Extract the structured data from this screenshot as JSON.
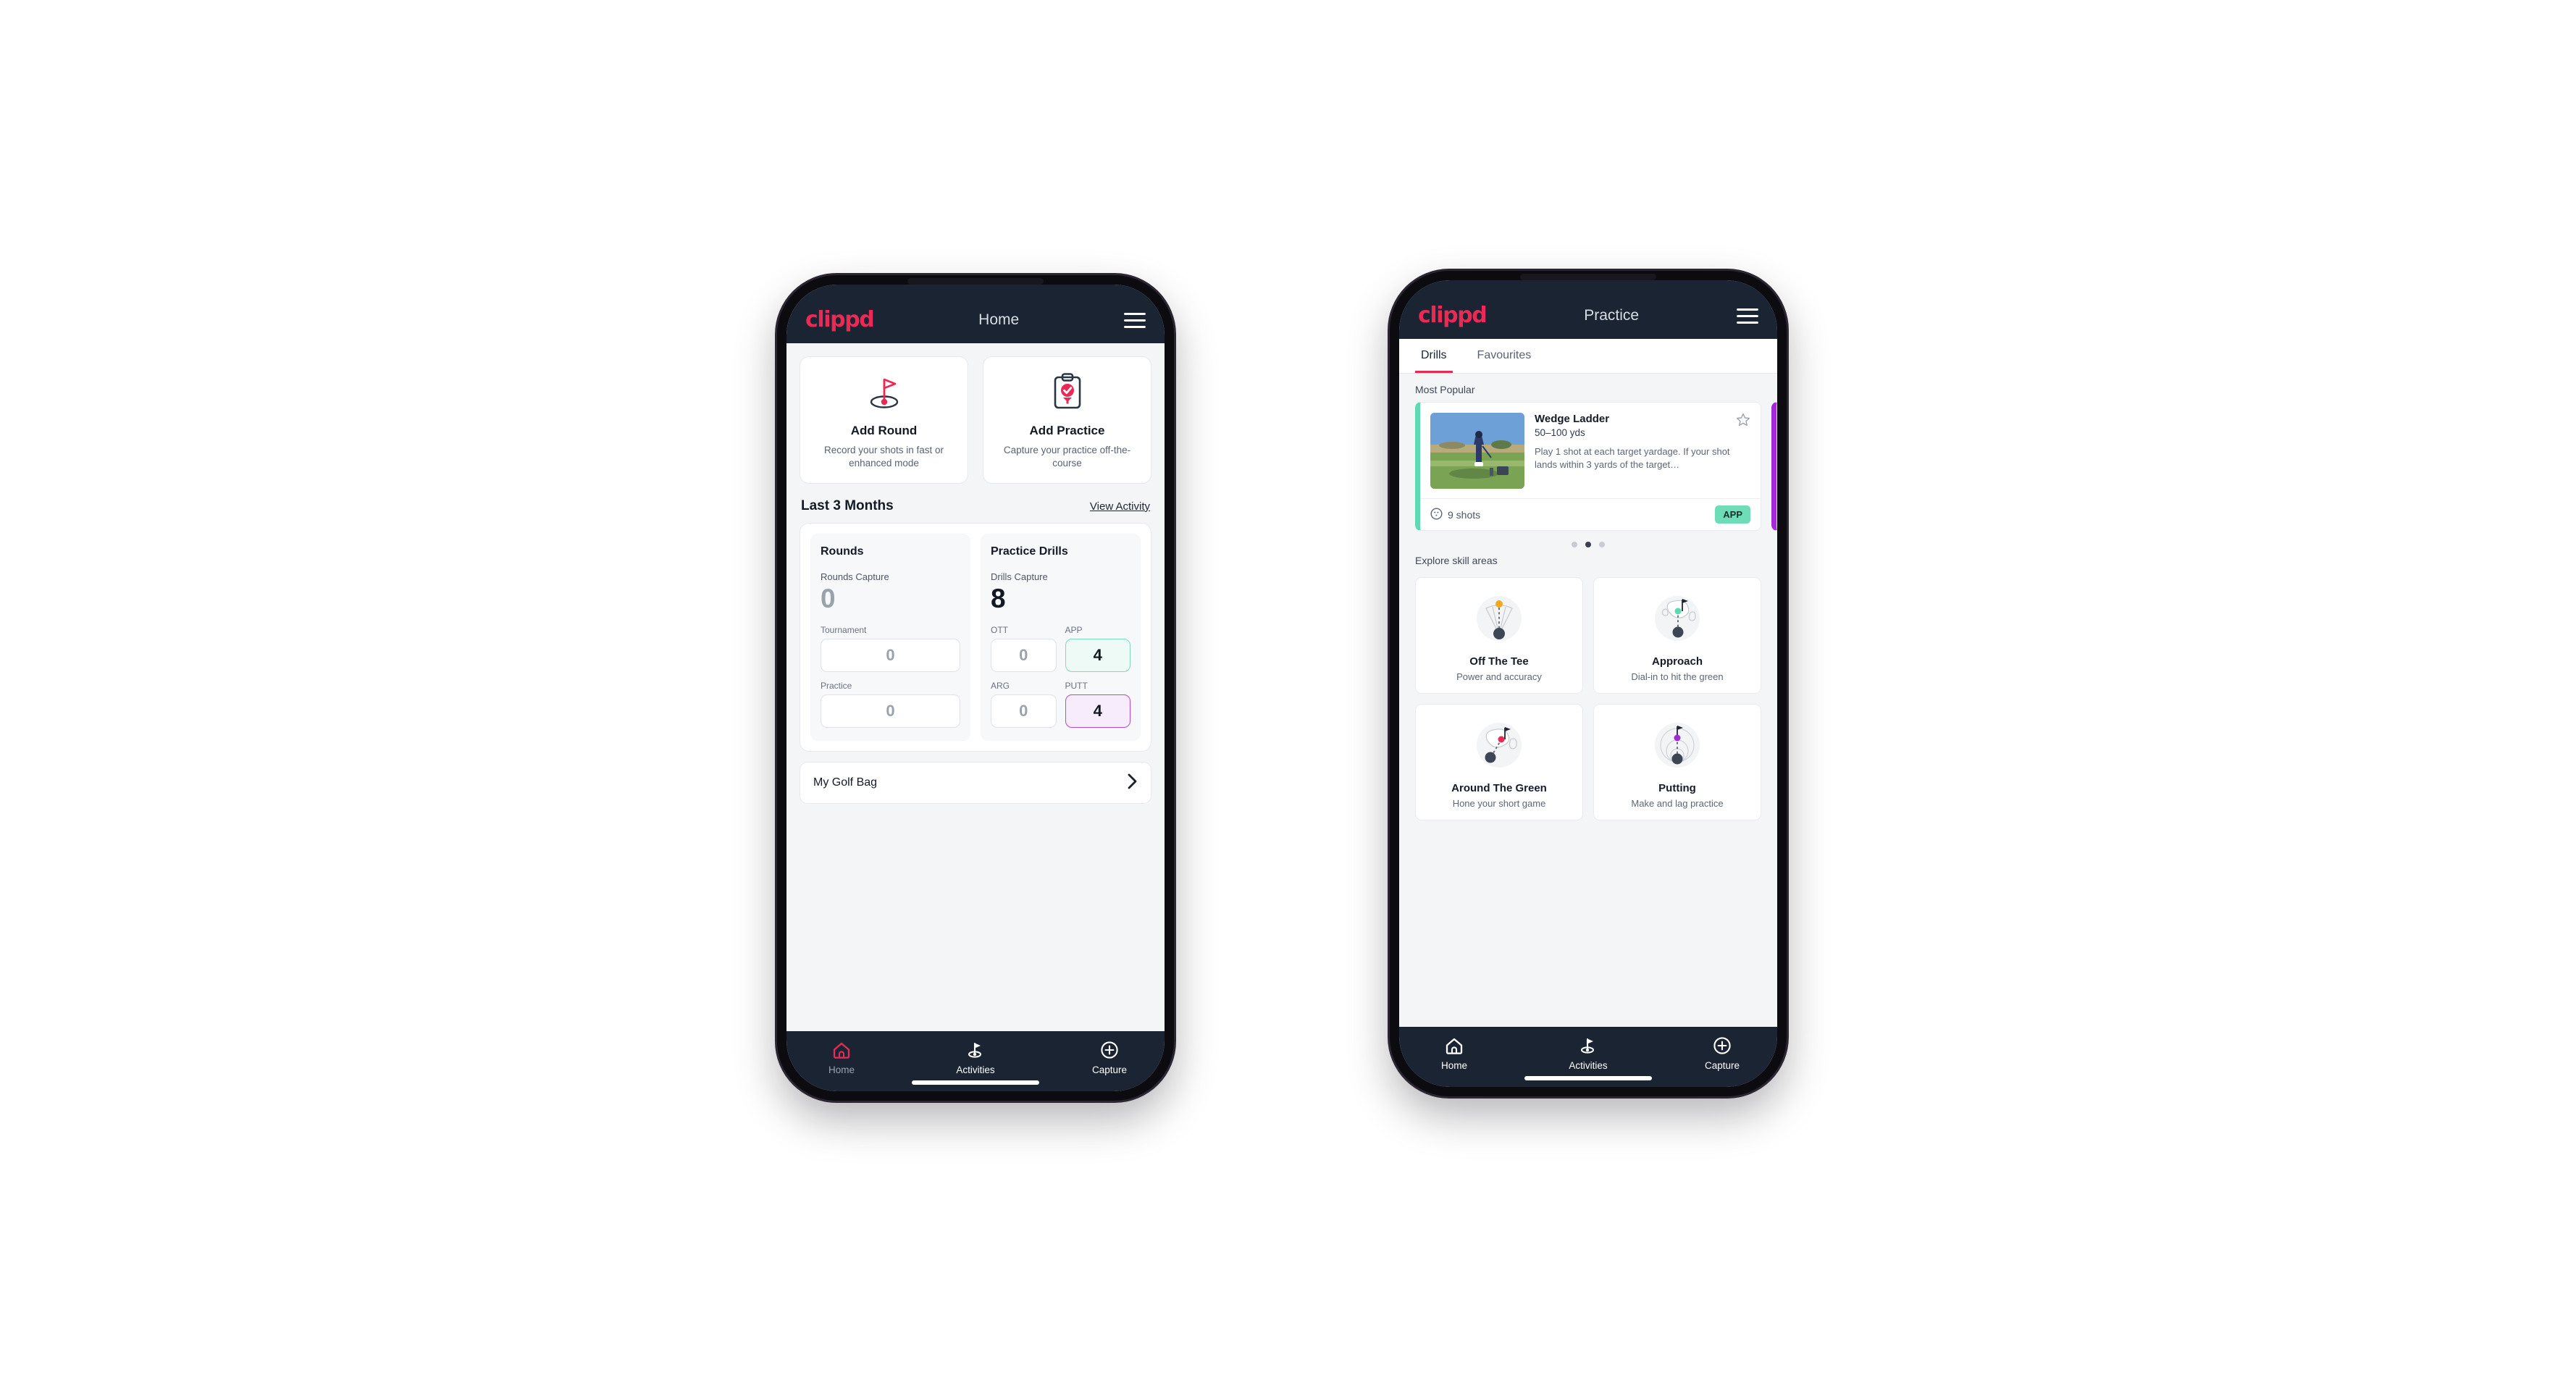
{
  "brand": "clippd",
  "phone_home": {
    "appbar": {
      "title": "Home",
      "menu_icon": "hamburger-menu-icon"
    },
    "actions": [
      {
        "icon": "golf-flag-hole-icon",
        "title": "Add Round",
        "subtitle": "Record your shots in fast or enhanced mode"
      },
      {
        "icon": "clipboard-check-icon",
        "title": "Add Practice",
        "subtitle": "Capture your practice off-the-course"
      }
    ],
    "section": {
      "title": "Last 3 Months",
      "link": "View Activity"
    },
    "rounds": {
      "title": "Rounds",
      "capture_label": "Rounds Capture",
      "capture_value": "0",
      "items": [
        {
          "label": "Tournament",
          "value": "0",
          "highlight": "none"
        },
        {
          "label": "Practice",
          "value": "0",
          "highlight": "none"
        }
      ]
    },
    "drills": {
      "title": "Practice Drills",
      "capture_label": "Drills Capture",
      "capture_value": "8",
      "items": [
        {
          "label": "OTT",
          "value": "0",
          "highlight": "none"
        },
        {
          "label": "APP",
          "value": "4",
          "highlight": "green"
        },
        {
          "label": "ARG",
          "value": "0",
          "highlight": "none"
        },
        {
          "label": "PUTT",
          "value": "4",
          "highlight": "purple"
        }
      ]
    },
    "golf_bag": {
      "label": "My Golf Bag",
      "chevron_icon": "chevron-right-icon"
    },
    "nav": [
      {
        "icon": "home-icon",
        "label": "Home",
        "active": true
      },
      {
        "icon": "golf-flag-icon",
        "label": "Activities",
        "active": false
      },
      {
        "icon": "plus-circle-icon",
        "label": "Capture",
        "active": false
      }
    ]
  },
  "phone_practice": {
    "appbar": {
      "title": "Practice",
      "menu_icon": "hamburger-menu-icon"
    },
    "tabs": [
      {
        "label": "Drills",
        "active": true
      },
      {
        "label": "Favourites",
        "active": false
      }
    ],
    "most_popular_label": "Most Popular",
    "drill": {
      "title": "Wedge Ladder",
      "range": "50–100 yds",
      "description": "Play 1 shot at each target yardage. If your shot lands within 3 yards of the target…",
      "shots": "9 shots",
      "shots_icon": "golf-ball-icon",
      "badge": "APP",
      "star_icon": "star-outline-icon",
      "accent": "#5fd9b4",
      "badge_color": "#6edcb7"
    },
    "peek_accent": "#a32ad8",
    "dots": [
      {
        "active": false
      },
      {
        "active": true
      },
      {
        "active": false
      }
    ],
    "skill_label": "Explore skill areas",
    "skills": [
      {
        "icon": "tee-shot-fan-icon",
        "title": "Off The Tee",
        "subtitle": "Power and accuracy",
        "dot": "#f2a81d"
      },
      {
        "icon": "approach-green-icon",
        "title": "Approach",
        "subtitle": "Dial-in to hit the green",
        "dot": "#5fd9b4"
      },
      {
        "icon": "around-green-icon",
        "title": "Around The Green",
        "subtitle": "Hone your short game",
        "dot": "#ea2a55"
      },
      {
        "icon": "putting-rings-icon",
        "title": "Putting",
        "subtitle": "Make and lag practice",
        "dot": "#a32ad8"
      }
    ],
    "nav": [
      {
        "icon": "home-icon",
        "label": "Home",
        "active": false
      },
      {
        "icon": "golf-flag-icon",
        "label": "Activities",
        "active": false
      },
      {
        "icon": "plus-circle-icon",
        "label": "Capture",
        "active": false
      }
    ]
  },
  "colors": {
    "brand_pink": "#ea2a55",
    "appbar_dark": "#1b2432",
    "green": "#5fd9b4",
    "purple": "#a32ad8",
    "page_bg": "#f4f5f7"
  }
}
